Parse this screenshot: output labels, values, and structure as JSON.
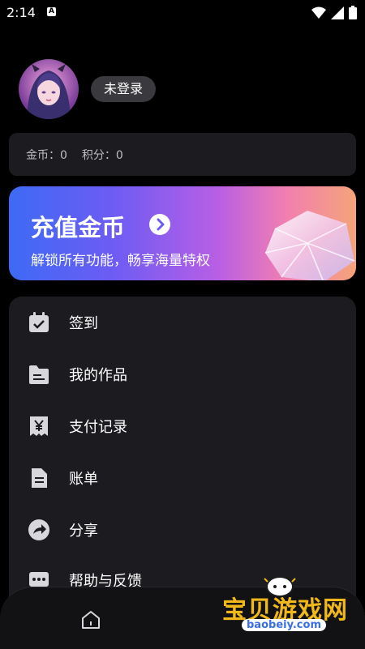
{
  "status_bar": {
    "time": "2:14",
    "notification_letter": "A"
  },
  "profile": {
    "login_status": "未登录"
  },
  "points": {
    "coins_label": "金币：",
    "coins_value": "0",
    "score_label": "积分：",
    "score_value": "0"
  },
  "banner": {
    "title": "充值金币",
    "subtitle": "解锁所有功能，畅享海量特权"
  },
  "menu": [
    {
      "label": "签到",
      "icon": "calendar-check-icon"
    },
    {
      "label": "我的作品",
      "icon": "folder-icon"
    },
    {
      "label": "支付记录",
      "icon": "yuan-receipt-icon"
    },
    {
      "label": "账单",
      "icon": "document-icon"
    },
    {
      "label": "分享",
      "icon": "share-icon"
    },
    {
      "label": "帮助与反馈",
      "icon": "chat-bubble-icon"
    }
  ],
  "watermark": {
    "text": "宝贝游戏网",
    "url": "baobeiy.com"
  },
  "colors": {
    "background": "#000000",
    "card": "#1c1c20",
    "banner_start": "#3d6af5",
    "banner_end": "#f4a47a",
    "icon": "#d8d8dc"
  }
}
